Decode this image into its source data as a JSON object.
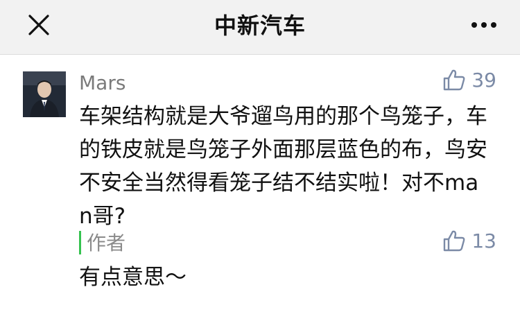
{
  "navbar": {
    "title": "中新汽车",
    "close_icon": "close-icon",
    "more_icon": "more-horizontal-icon"
  },
  "comment": {
    "author": "Mars",
    "likes": "39",
    "text": "车架结构就是大爷遛鸟用的那个鸟笼子，车的铁皮就是鸟笼子外面那层蓝色的布，鸟安不安全当然得看笼子结不结实啦！对不man哥?",
    "avatar_icon": "user-avatar"
  },
  "reply": {
    "label": "作者",
    "likes": "13",
    "text": "有点意思～"
  },
  "colors": {
    "navbar_bg": "#f2f2f2",
    "like_blue": "#7b8aa6",
    "author_bar_green": "#35c24f",
    "muted_text": "#7a7a7a"
  }
}
